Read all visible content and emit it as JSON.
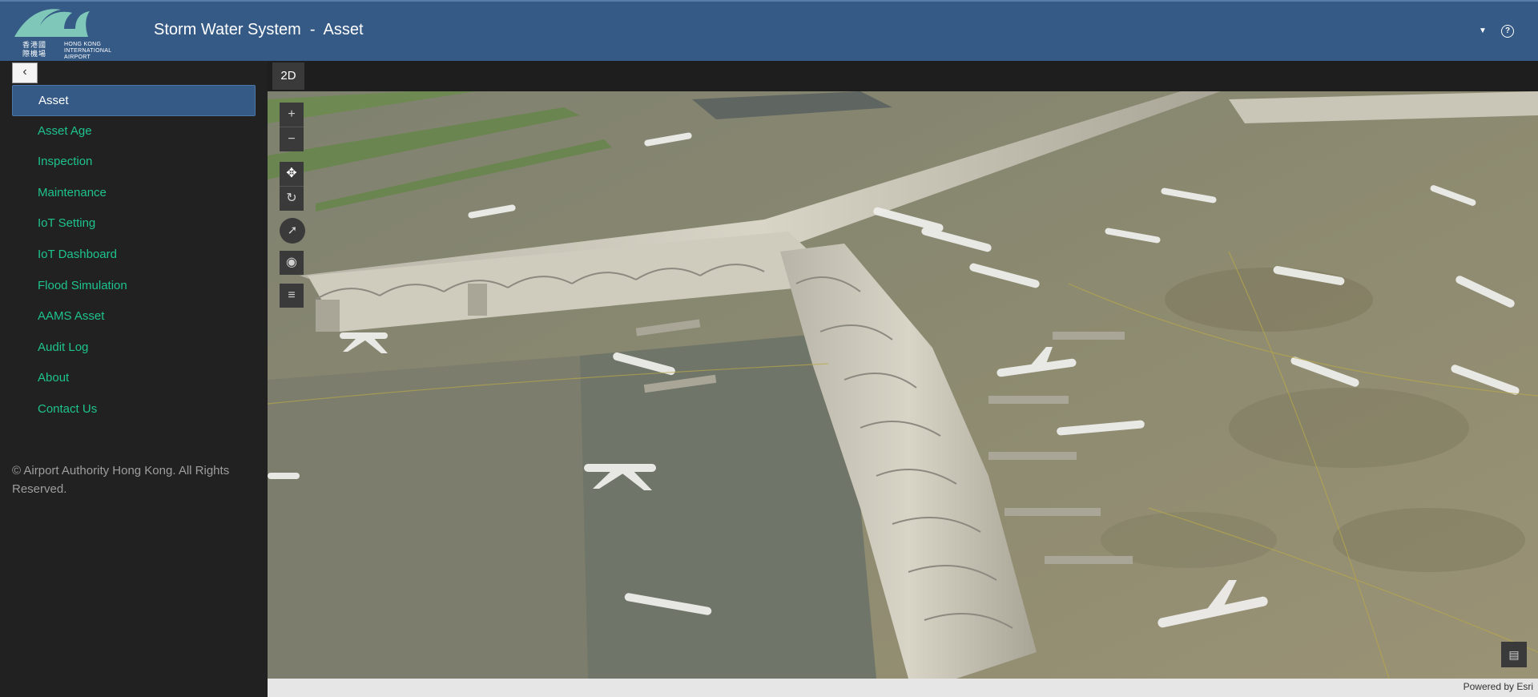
{
  "header": {
    "title": "Storm Water System  -  Asset",
    "logo_cn": "香港國際機場",
    "logo_en": "HONG KONG INTERNATIONAL AIRPORT",
    "caret_icon": "caret-down-icon",
    "help_icon": "help-icon"
  },
  "sidebar": {
    "collapse_icon": "chevron-left-icon",
    "items": [
      {
        "label": "Asset",
        "active": true
      },
      {
        "label": "Asset Age"
      },
      {
        "label": "Inspection"
      },
      {
        "label": "Maintenance"
      },
      {
        "label": "IoT Setting"
      },
      {
        "label": "IoT Dashboard"
      },
      {
        "label": "Flood Simulation"
      },
      {
        "label": "AAMS Asset"
      },
      {
        "label": "Audit Log"
      },
      {
        "label": "About"
      },
      {
        "label": "Contact Us"
      }
    ],
    "copyright": "© Airport Authority Hong Kong. All Rights Reserved."
  },
  "map": {
    "view_toggle": "2D",
    "attribution": "Powered by Esri",
    "tools": [
      "zoom-in-icon",
      "zoom-out-icon",
      "pan-icon",
      "rotate-icon",
      "compass-icon",
      "layers-icon",
      "list-icon"
    ],
    "colors": {
      "accent": "#355a86",
      "nav_text": "#1ec38e",
      "sidebar_bg": "#212121"
    }
  }
}
